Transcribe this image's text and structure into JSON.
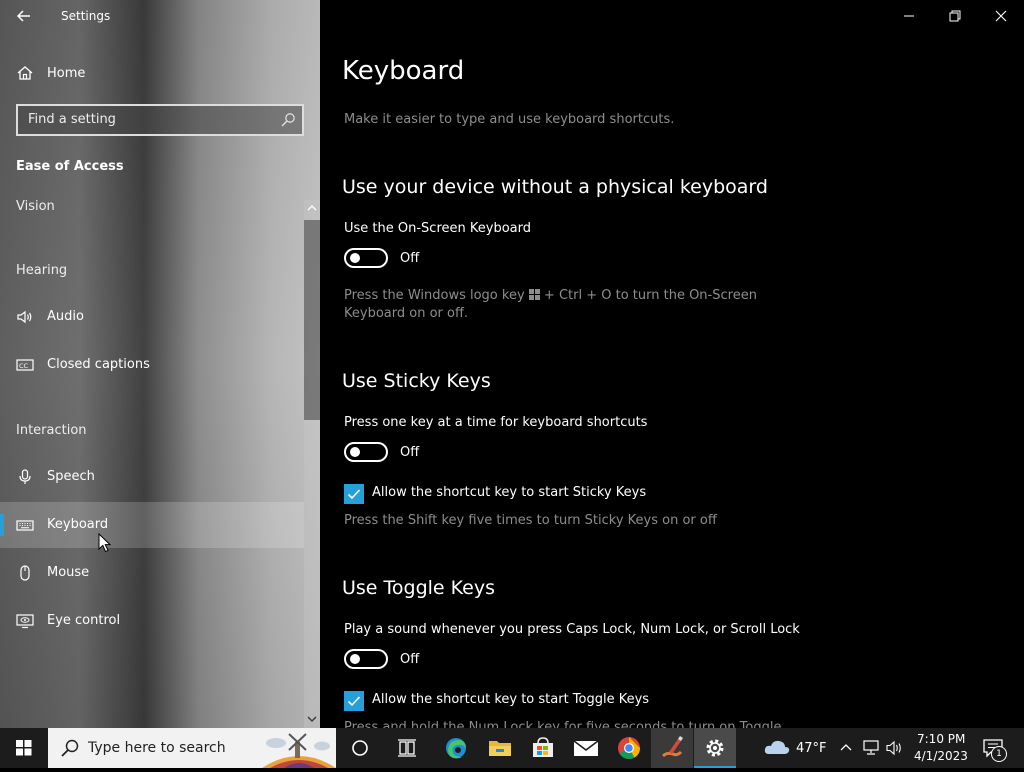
{
  "window": {
    "title": "Settings",
    "controls": {
      "minimize": "minimize-icon",
      "restore": "restore-icon",
      "close": "close-icon"
    }
  },
  "sidebar": {
    "home_label": "Home",
    "search_placeholder": "Find a setting",
    "section_title": "Ease of Access",
    "groups": {
      "vision": "Vision",
      "hearing": "Hearing",
      "interaction": "Interaction"
    },
    "items": {
      "audio": "Audio",
      "closed_captions": "Closed captions",
      "speech": "Speech",
      "keyboard": "Keyboard",
      "mouse": "Mouse",
      "eye_control": "Eye control"
    },
    "selected": "keyboard"
  },
  "main": {
    "title": "Keyboard",
    "subtitle": "Make it easier to type and use keyboard shortcuts.",
    "onscreen": {
      "heading": "Use your device without a physical keyboard",
      "label": "Use the On-Screen Keyboard",
      "state": "Off",
      "desc_before": "Press the Windows logo key",
      "desc_after": "+ Ctrl + O to turn the On-Screen",
      "desc_line2": "Keyboard on or off."
    },
    "sticky": {
      "heading": "Use Sticky Keys",
      "label": "Press one key at a time for keyboard shortcuts",
      "state": "Off",
      "checkbox_label": "Allow the shortcut key to start Sticky Keys",
      "checkbox_checked": true,
      "desc": "Press the Shift key five times to turn Sticky Keys on or off"
    },
    "toggle_keys": {
      "heading": "Use Toggle Keys",
      "label": "Play a sound whenever you press Caps Lock, Num Lock, or Scroll Lock",
      "state": "Off",
      "checkbox_label": "Allow the shortcut key to start Toggle Keys",
      "checkbox_checked": true,
      "desc_partial": "Press and hold the Num Lock key for five seconds to turn on Toggle"
    }
  },
  "taskbar": {
    "search_placeholder": "Type here to search",
    "weather": "47°F",
    "time": "7:10 PM",
    "date": "4/1/2023",
    "notification_count": "1",
    "accent": "#26a0da"
  }
}
